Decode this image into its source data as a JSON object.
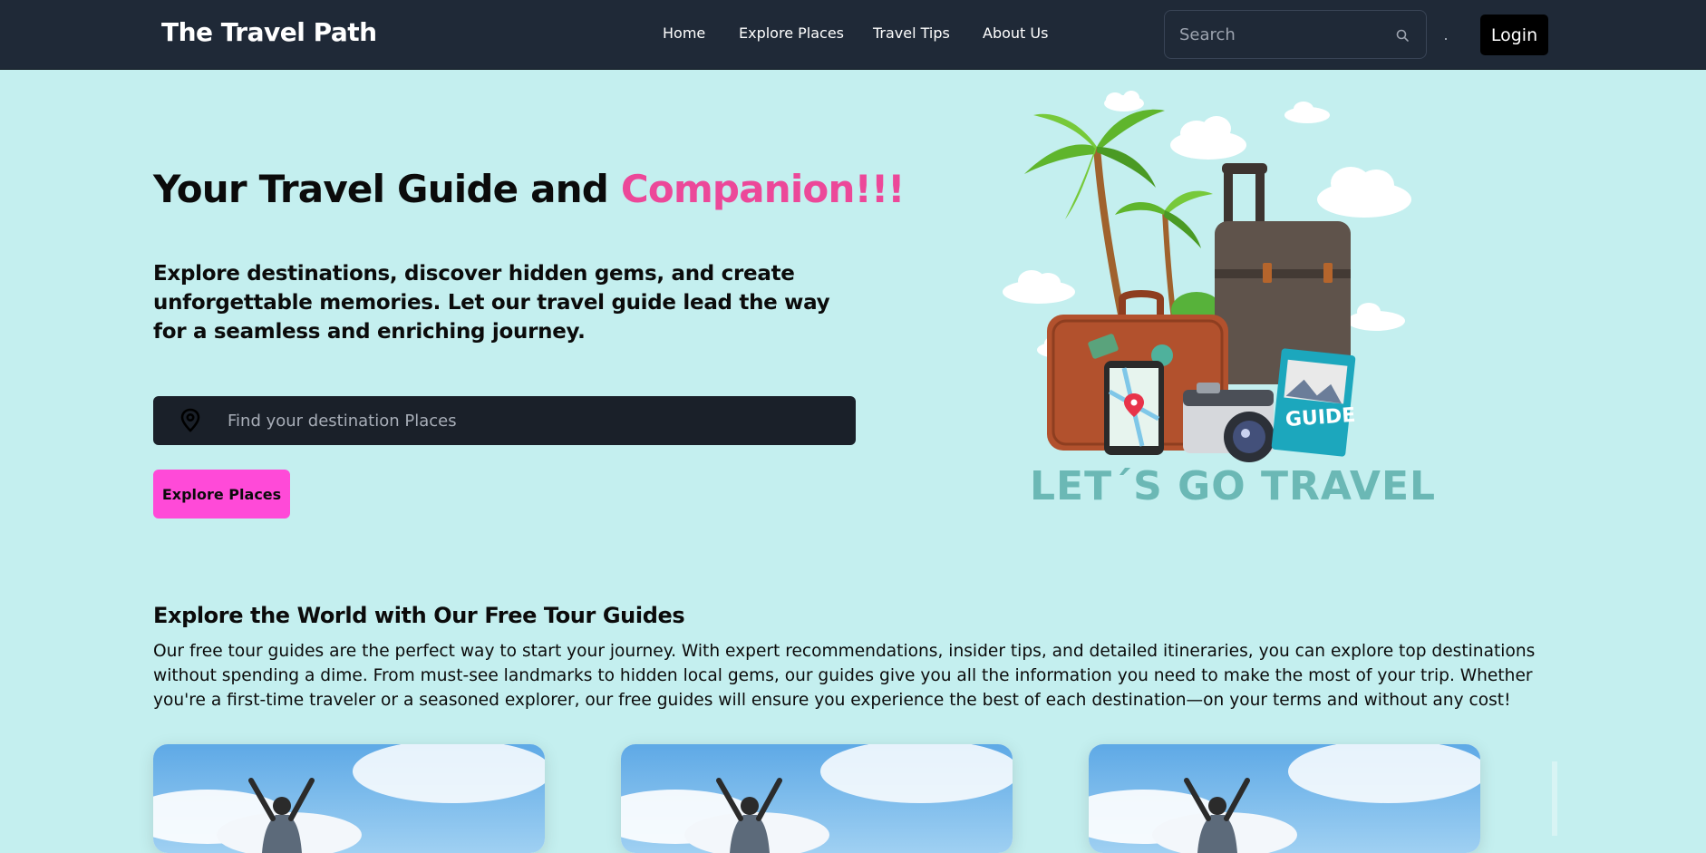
{
  "nav": {
    "brand": "The Travel Path",
    "links": [
      "Home",
      "Explore Places",
      "Travel Tips",
      "About Us"
    ],
    "search_placeholder": "Search",
    "login_label": "Login"
  },
  "hero": {
    "title_main": "Your Travel Guide and ",
    "title_accent": "Companion!!!",
    "subtitle": "Explore destinations, discover hidden gems, and create unforgettable memories. Let our travel guide lead the way for a seamless and enriching journey.",
    "destination_placeholder": "Find your destination Places",
    "cta_label": "Explore Places",
    "art_caption": "LET´S GO TRAVEL",
    "art_badge": "GUIDE"
  },
  "section": {
    "title": "Explore the World with Our Free Tour Guides",
    "text": "Our free tour guides are the perfect way to start your journey. With expert recommendations, insider tips, and detailed itineraries, you can explore top destinations without spending a dime. From must-see landmarks to hidden local gems, our guides give you all the information you need to make the most of your trip. Whether you're a first-time traveler or a seasoned explorer, our free guides will ensure you experience the best of each destination—on your terms and without any cost!"
  },
  "cards": [
    {},
    {},
    {}
  ],
  "colors": {
    "nav_bg": "#1f2937",
    "page_bg": "#c4efef",
    "accent_pink": "#ec4899",
    "cta_bg": "#ff4ad8",
    "caption_teal": "#6bb8b5"
  },
  "icons": {
    "search": "search-icon",
    "pin": "map-pin-icon"
  }
}
